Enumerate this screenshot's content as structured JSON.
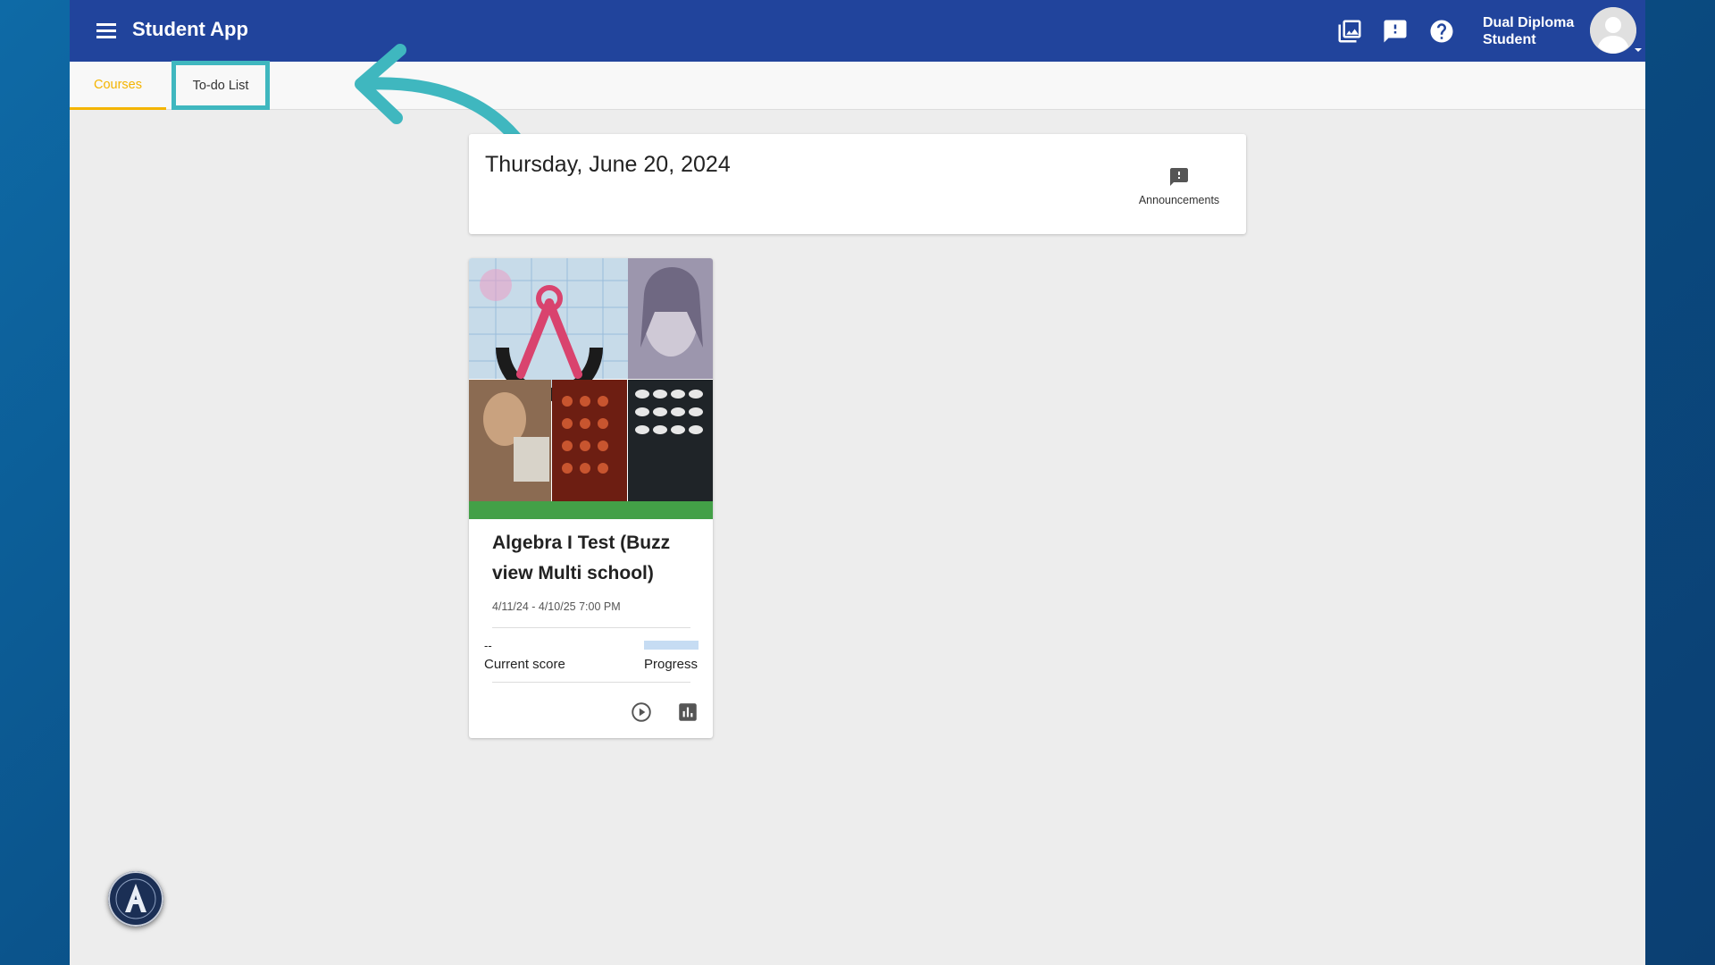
{
  "header": {
    "app_title": "Student App",
    "user_name_line1": "Dual Diploma",
    "user_name_line2": "Student",
    "icons": [
      "gallery-icon",
      "feedback-icon",
      "help-icon"
    ]
  },
  "tabs": [
    {
      "label": "Courses",
      "active": true
    },
    {
      "label": "To-do List",
      "active": false
    }
  ],
  "date_card": {
    "date": "Thursday, June 20, 2024",
    "announcements_label": "Announcements"
  },
  "course": {
    "title": "Algebra I Test (Buzz view Multi school)",
    "dates": "4/11/24 - 4/10/25 7:00 PM",
    "current_score_value": "--",
    "current_score_label": "Current score",
    "progress_label": "Progress",
    "progress_fraction": 0,
    "accent_color": "#43a047"
  },
  "colors": {
    "header_bg": "#21449c",
    "active_tab": "#f4b400",
    "highlight": "#3fb7bf"
  }
}
